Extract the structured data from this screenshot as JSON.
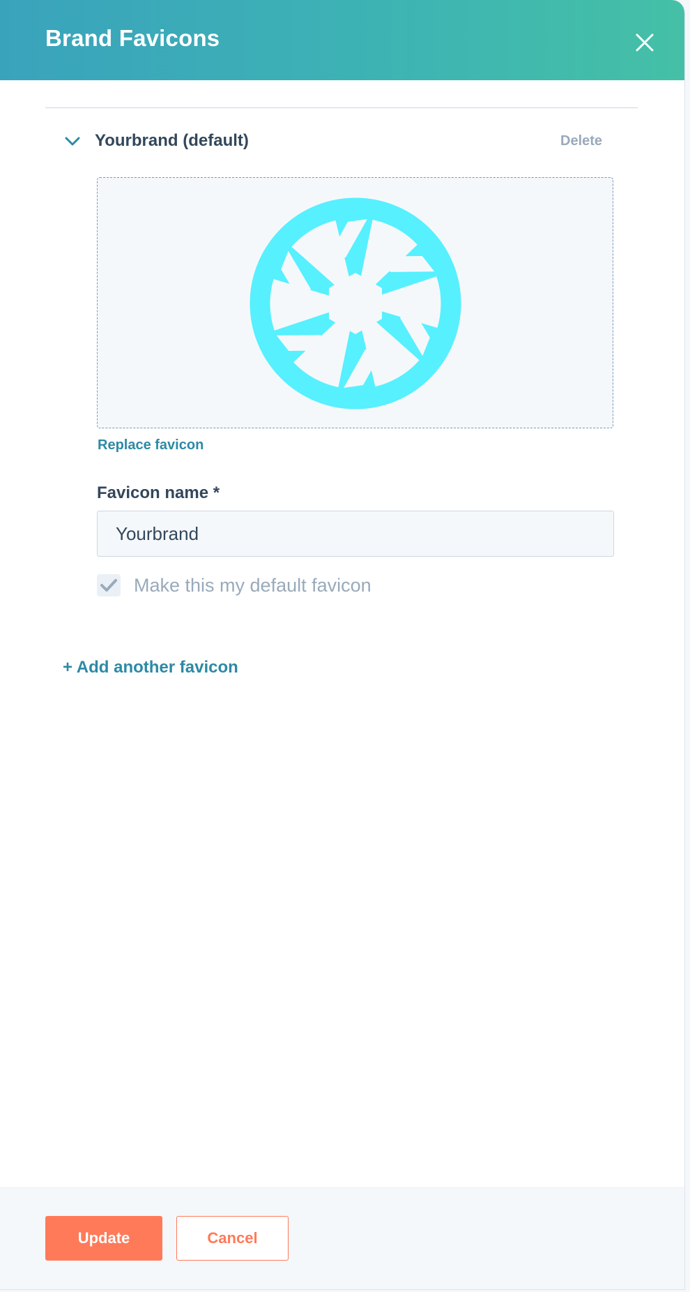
{
  "header": {
    "title": "Brand Favicons",
    "close_icon": "close-icon",
    "gradient_colors": [
      "#3aa3bc",
      "#45c0a6"
    ]
  },
  "favicon_section": {
    "title": "Yourbrand (default)",
    "expanded": true,
    "delete_label": "Delete",
    "preview_icon": "camera-aperture-icon",
    "preview_icon_color": "#56f0ff",
    "replace_label": "Replace favicon"
  },
  "form": {
    "name_label": "Favicon name *",
    "name_value": "Yourbrand",
    "default_checkbox_label": "Make this my default favicon",
    "default_checked": true
  },
  "add_another_label": "+ Add another favicon",
  "footer": {
    "update_label": "Update",
    "cancel_label": "Cancel"
  },
  "colors": {
    "accent_orange": "#ff7a59",
    "link_teal": "#2c8aa5",
    "text_dark": "#33475b",
    "text_muted": "#99aabb"
  }
}
